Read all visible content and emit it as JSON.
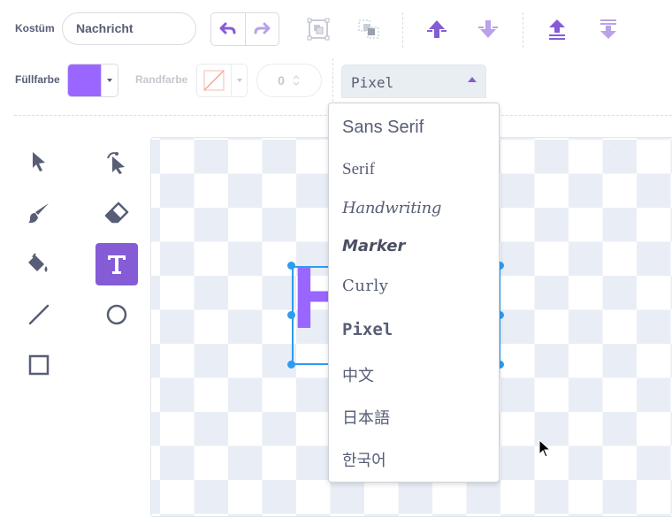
{
  "toolbar": {
    "costume_label": "Kostüm",
    "costume_name": "Nachricht",
    "fill_label": "Füllfarbe",
    "outline_label": "Randfarbe",
    "outline_width": "0"
  },
  "colors": {
    "accent": "#855cd6",
    "accent_light": "#b9a2e8",
    "fill_color": "#9966ff",
    "text_gray": "#575e75"
  },
  "font_select": {
    "value": "Pixel",
    "options": [
      "Sans Serif",
      "Serif",
      "Handwriting",
      "Marker",
      "Curly",
      "Pixel",
      "中文",
      "日本語",
      "한국어"
    ]
  },
  "tools": [
    "select-tool",
    "reshape-tool",
    "brush-tool",
    "eraser-tool",
    "fill-tool",
    "text-tool",
    "line-tool",
    "circle-tool",
    "rectangle-tool"
  ],
  "active_tool": "text-tool",
  "canvas": {
    "text_glyph": "H"
  }
}
